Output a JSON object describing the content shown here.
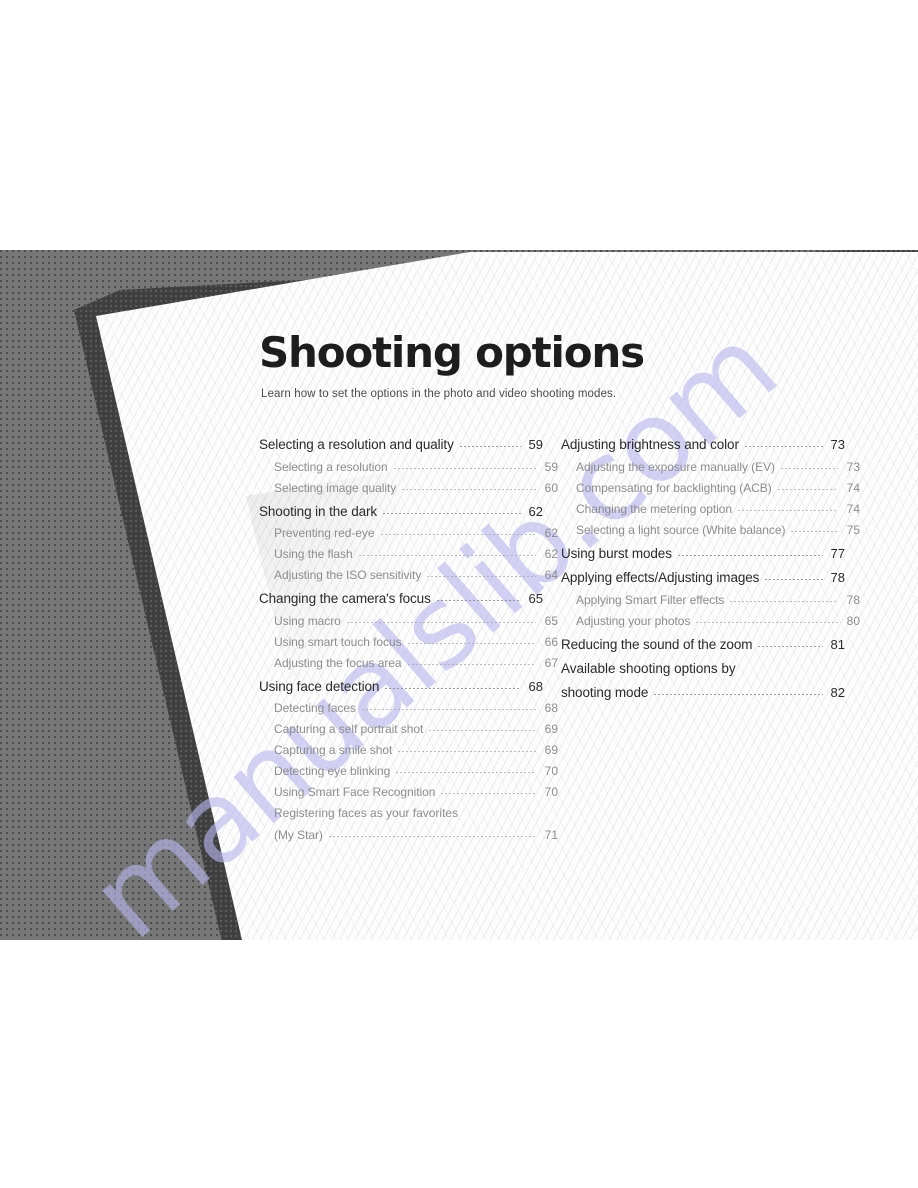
{
  "page": {
    "title": "Shooting options",
    "subtitle": "Learn how to set the options in the photo and video shooting modes.",
    "watermark": "manualslib.com",
    "colors": {
      "backdrop_gray": "#777777",
      "fold_shadow": "#3f3f3f",
      "sheet_white": "#fdfdfd",
      "heading_text": "#2a2a2a",
      "sub_text": "#8d8d8d",
      "watermark": "#b9b6ee"
    }
  },
  "toc": {
    "left_column": [
      {
        "level": "main",
        "label": "Selecting a resolution and quality",
        "page": "59"
      },
      {
        "level": "sub",
        "label": "Selecting a resolution",
        "page": "59"
      },
      {
        "level": "sub",
        "label": "Selecting image quality",
        "page": "60"
      },
      {
        "level": "main",
        "label": "Shooting in the dark",
        "page": "62"
      },
      {
        "level": "sub",
        "label": "Preventing red-eye",
        "page": "62"
      },
      {
        "level": "sub",
        "label": "Using the flash",
        "page": "62"
      },
      {
        "level": "sub",
        "label": "Adjusting the ISO sensitivity",
        "page": "64"
      },
      {
        "level": "main",
        "label": "Changing the camera's focus",
        "page": "65"
      },
      {
        "level": "sub",
        "label": "Using macro",
        "page": "65"
      },
      {
        "level": "sub",
        "label": "Using smart touch focus",
        "page": "66"
      },
      {
        "level": "sub",
        "label": "Adjusting the focus area",
        "page": "67"
      },
      {
        "level": "main",
        "label": "Using face detection",
        "page": "68"
      },
      {
        "level": "sub",
        "label": "Detecting faces",
        "page": "68"
      },
      {
        "level": "sub",
        "label": "Capturing a self portrait shot",
        "page": "69"
      },
      {
        "level": "sub",
        "label": "Capturing a smile shot",
        "page": "69"
      },
      {
        "level": "sub",
        "label": "Detecting eye blinking",
        "page": "70"
      },
      {
        "level": "sub",
        "label": "Using Smart Face Recognition",
        "page": "70"
      },
      {
        "level": "sub",
        "label": "Registering faces as your favorites",
        "label2": "(My Star)",
        "page": "71"
      }
    ],
    "right_column": [
      {
        "level": "main",
        "label": "Adjusting brightness and color",
        "page": "73"
      },
      {
        "level": "sub",
        "label": "Adjusting the exposure manually (EV)",
        "page": "73"
      },
      {
        "level": "sub",
        "label": "Compensating for backlighting (ACB)",
        "page": "74"
      },
      {
        "level": "sub",
        "label": "Changing the metering option",
        "page": "74"
      },
      {
        "level": "sub",
        "label": "Selecting a light source (White balance)",
        "page": "75"
      },
      {
        "level": "main",
        "label": "Using burst modes",
        "page": "77"
      },
      {
        "level": "main",
        "label": "Applying effects/Adjusting images",
        "page": "78"
      },
      {
        "level": "sub",
        "label": "Applying Smart Filter effects",
        "page": "78"
      },
      {
        "level": "sub",
        "label": "Adjusting your photos",
        "page": "80"
      },
      {
        "level": "main",
        "label": "Reducing the sound of the zoom",
        "page": "81"
      },
      {
        "level": "main",
        "label": "Available shooting options by",
        "label2": "shooting mode",
        "page": "82"
      }
    ]
  }
}
